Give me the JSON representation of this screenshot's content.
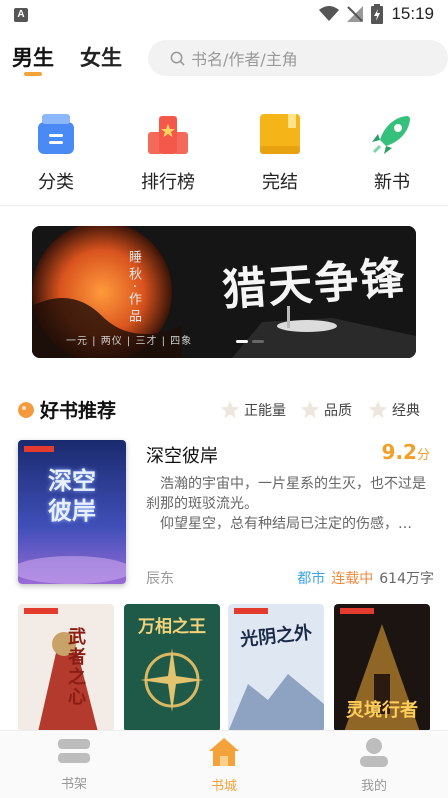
{
  "status_bar": {
    "time": "15:19",
    "app_icon": "A"
  },
  "header": {
    "tabs": [
      {
        "label": "男生",
        "active": true
      },
      {
        "label": "女生",
        "active": false
      }
    ],
    "search_placeholder": "书名/作者/主角"
  },
  "categories": [
    {
      "label": "分类",
      "icon": "category-icon"
    },
    {
      "label": "排行榜",
      "icon": "ranking-icon"
    },
    {
      "label": "完结",
      "icon": "completed-icon"
    },
    {
      "label": "新书",
      "icon": "new-book-icon"
    }
  ],
  "banner": {
    "author_text": "睡秋·作品",
    "title": "猎天争锋",
    "subtitle": "一元 | 两仪 | 三才 | 四象"
  },
  "recommend": {
    "title": "好书推荐",
    "filters": [
      "正能量",
      "品质",
      "经典"
    ],
    "featured": {
      "title": "深空彼岸",
      "score": "9.2",
      "score_unit": "分",
      "desc_line1": "浩瀚的宇宙中，一片星系的生灭，也不过是刹那的斑驳流光。",
      "desc_line2": "仰望星空，总有种结局已注定的伤感，…",
      "author": "辰东",
      "tag_genre": "都市",
      "tag_status": "连载中",
      "word_count": "614万字",
      "cover_text": "深空彼岸"
    },
    "thumbs": [
      {
        "cover_text": "武者之心"
      },
      {
        "cover_text": "万相之王"
      },
      {
        "cover_text": "光阴之外"
      },
      {
        "cover_text": "灵境行者"
      }
    ]
  },
  "bottom_nav": [
    {
      "label": "书架",
      "active": false
    },
    {
      "label": "书城",
      "active": true
    },
    {
      "label": "我的",
      "active": false
    }
  ],
  "colors": {
    "accent": "#f4a23a",
    "tag_blue": "#3da4e0",
    "tag_orange": "#f08a3c"
  }
}
